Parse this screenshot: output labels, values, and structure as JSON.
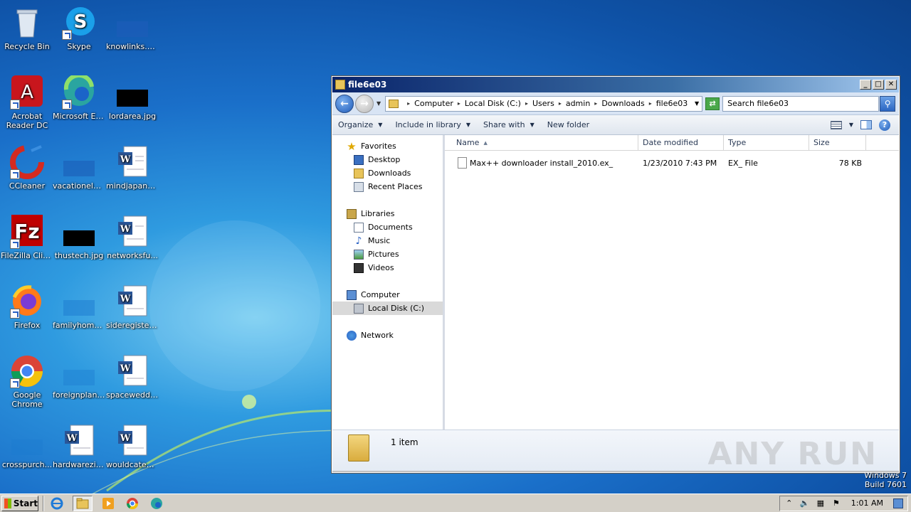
{
  "desktop": {
    "icons": [
      {
        "label": "Recycle Bin",
        "icon": "recycle-bin-icon"
      },
      {
        "label": "Skype",
        "icon": "skype-icon"
      },
      {
        "label": "knowlinks.png",
        "icon": "image-file-icon"
      },
      {
        "label": "Acrobat Reader DC",
        "icon": "acrobat-icon"
      },
      {
        "label": "Microsoft Edge",
        "icon": "edge-icon"
      },
      {
        "label": "lordarea.jpg",
        "icon": "image-file-icon"
      },
      {
        "label": "CCleaner",
        "icon": "ccleaner-icon"
      },
      {
        "label": "vacationele...",
        "icon": "image-file-icon"
      },
      {
        "label": "mindjapane...",
        "icon": "word-doc-icon"
      },
      {
        "label": "FileZilla Client",
        "icon": "filezilla-icon"
      },
      {
        "label": "thustech.jpg",
        "icon": "image-file-icon"
      },
      {
        "label": "networksfu...",
        "icon": "word-doc-icon"
      },
      {
        "label": "Firefox",
        "icon": "firefox-icon"
      },
      {
        "label": "familyhome....",
        "icon": "image-file-icon"
      },
      {
        "label": "sideregister....",
        "icon": "word-doc-icon"
      },
      {
        "label": "Google Chrome",
        "icon": "chrome-icon"
      },
      {
        "label": "foreignplan....",
        "icon": "image-file-icon"
      },
      {
        "label": "spaceweddi...",
        "icon": "word-doc-icon"
      },
      {
        "label": "crosspurch...",
        "icon": "image-file-icon"
      },
      {
        "label": "hardwarezip...",
        "icon": "word-doc-icon"
      },
      {
        "label": "wouldcateg...",
        "icon": "word-doc-icon"
      }
    ]
  },
  "window": {
    "title": "file6e03",
    "buttons": {
      "minimize": "_",
      "maximize": "□",
      "close": "✕"
    },
    "address": {
      "crumbs": [
        "Computer",
        "Local Disk (C:)",
        "Users",
        "admin",
        "Downloads",
        "file6e03"
      ],
      "separator": "▸"
    },
    "search_placeholder": "Search file6e03",
    "toolbar": {
      "organize": "Organize",
      "include_in_library": "Include in library",
      "share_with": "Share with",
      "new_folder": "New folder"
    },
    "nav": {
      "favorites": "Favorites",
      "desktop": "Desktop",
      "downloads": "Downloads",
      "recent_places": "Recent Places",
      "libraries": "Libraries",
      "documents": "Documents",
      "music": "Music",
      "pictures": "Pictures",
      "videos": "Videos",
      "computer": "Computer",
      "local_disk": "Local Disk (C:)",
      "network": "Network"
    },
    "columns": {
      "name": "Name",
      "date": "Date modified",
      "type": "Type",
      "size": "Size"
    },
    "files": [
      {
        "name": "Max++ downloader install_2010.ex_",
        "date": "1/23/2010 7:43 PM",
        "type": "EX_ File",
        "size": "78 KB"
      }
    ],
    "status": {
      "count": "1 item"
    }
  },
  "watermark": "ANY RUN",
  "os_build": {
    "line0": "Windows 7",
    "line1": "Build 7601"
  },
  "taskbar": {
    "start_label": "Start",
    "clock": "1:01 AM"
  }
}
